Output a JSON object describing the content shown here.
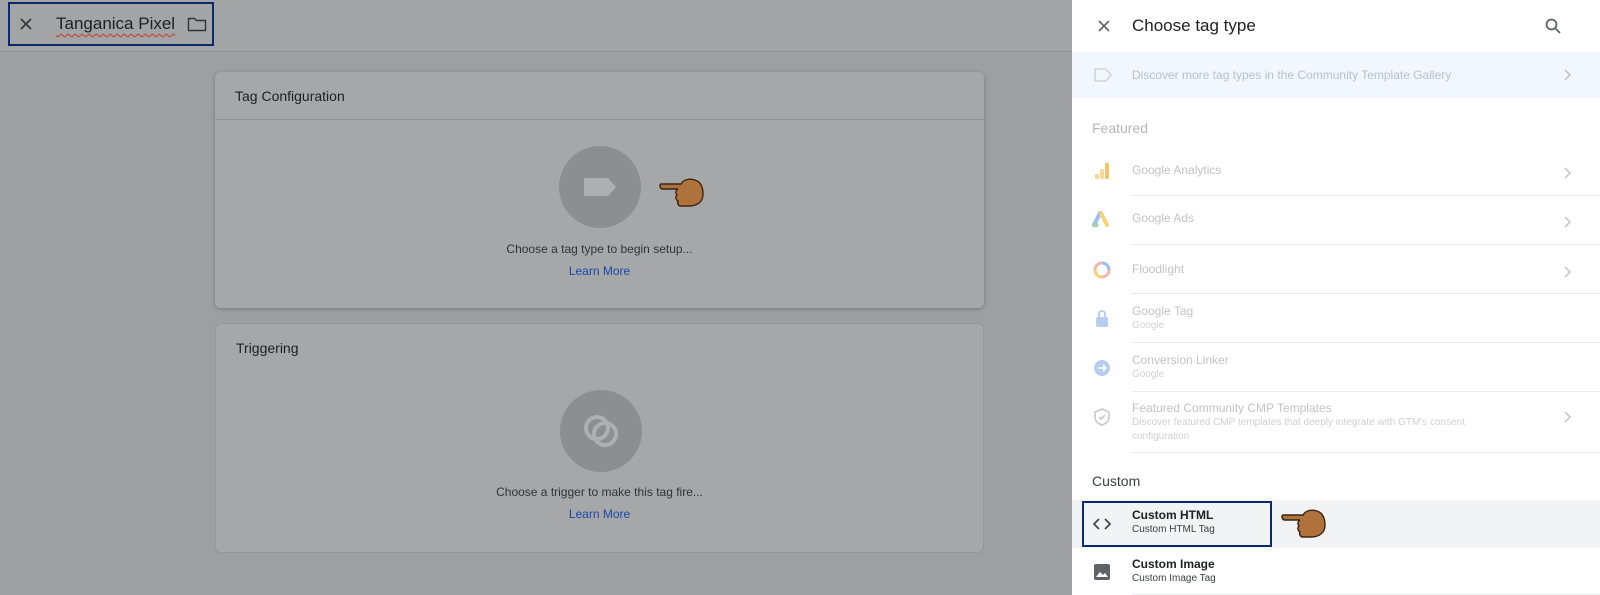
{
  "editor": {
    "tag_name": "Tanganica Pixel",
    "tag_configuration": {
      "title": "Tag Configuration",
      "message": "Choose a tag type to begin setup...",
      "link": "Learn More"
    },
    "triggering": {
      "title": "Triggering",
      "message": "Choose a trigger to make this tag fire...",
      "link": "Learn More"
    }
  },
  "panel": {
    "title": "Choose tag type",
    "gallery_text": "Discover more tag types in the Community Template Gallery",
    "featured_label": "Featured",
    "featured_items": [
      {
        "name": "Google Analytics",
        "icon": "analytics-icon"
      },
      {
        "name": "Google Ads",
        "icon": "google-ads-icon"
      },
      {
        "name": "Floodlight",
        "icon": "floodlight-icon"
      },
      {
        "name": "Google Tag",
        "sub": "Google",
        "icon": "lock-tag-icon"
      },
      {
        "name": "Conversion Linker",
        "sub": "Google",
        "icon": "linker-icon"
      },
      {
        "name": "Featured Community CMP Templates",
        "sub": "Discover featured CMP templates that deeply integrate with GTM's consent configuration",
        "icon": "shield-icon"
      }
    ],
    "custom_label": "Custom",
    "custom_items": [
      {
        "name": "Custom HTML",
        "sub": "Custom HTML Tag",
        "icon": "code-icon"
      },
      {
        "name": "Custom Image",
        "sub": "Custom Image Tag",
        "icon": "image-icon"
      }
    ]
  },
  "colors": {
    "highlight_border": "#0b2a6b",
    "link": "#1a47a8",
    "hand": "#b0723d"
  }
}
